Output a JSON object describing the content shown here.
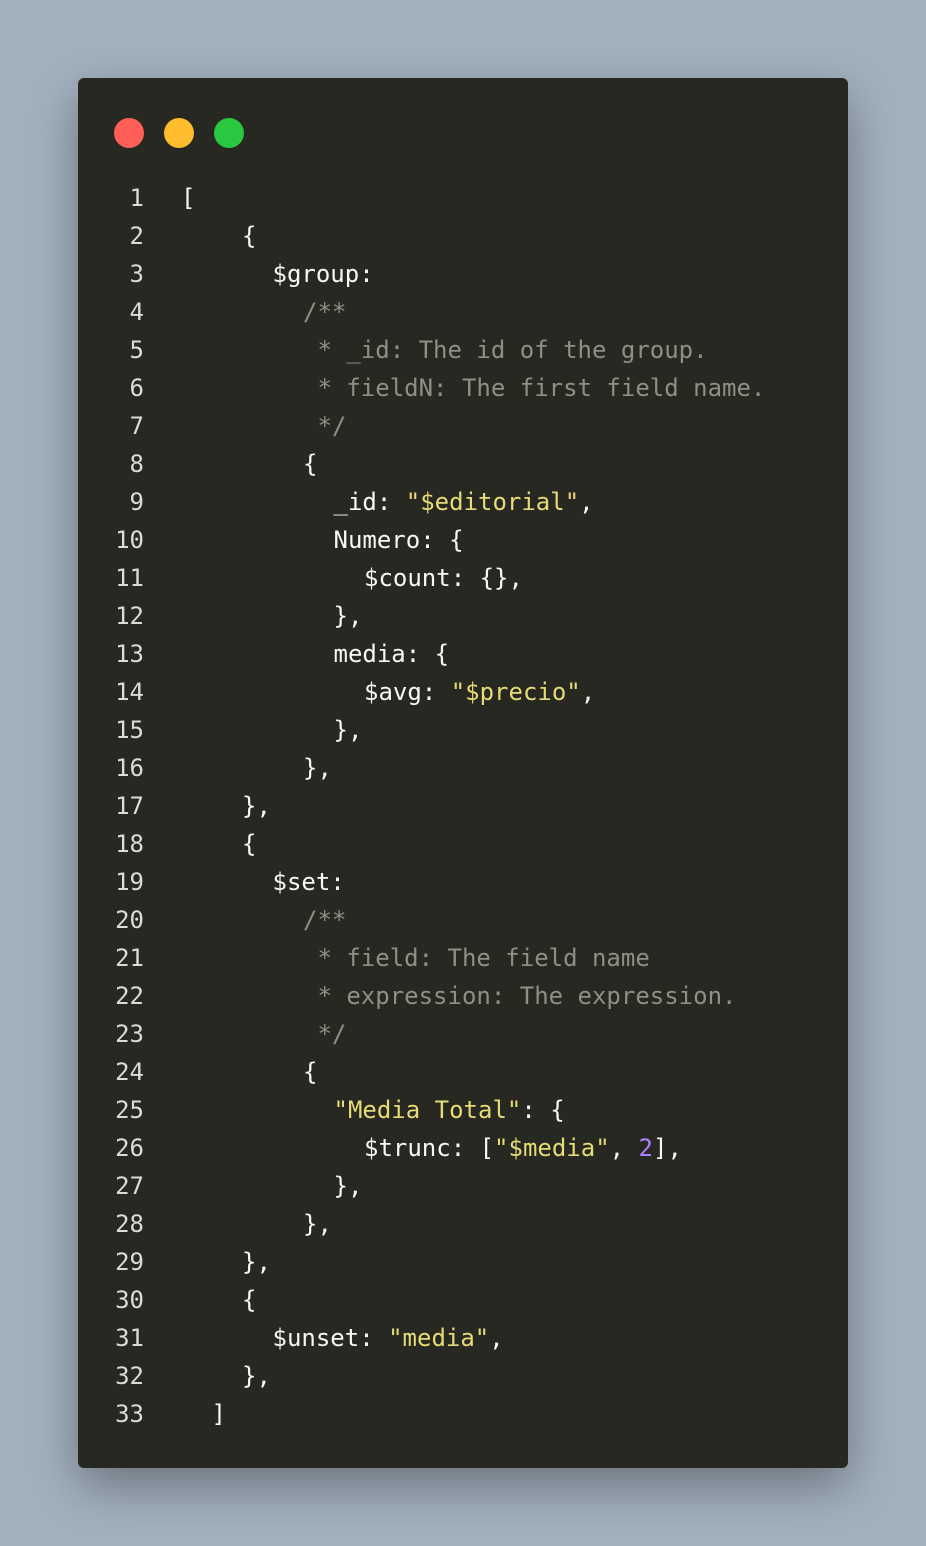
{
  "window": {
    "traffic_lights": [
      {
        "name": "close",
        "color": "#ff5f57"
      },
      {
        "name": "minimize",
        "color": "#febc2e"
      },
      {
        "name": "maximize",
        "color": "#28c840"
      }
    ]
  },
  "colors": {
    "background": "#a3b1bf",
    "editor": "#272822",
    "text": "#f8f8f2",
    "string": "#e6db74",
    "number": "#ae81ff",
    "comment": "#8f8f84"
  },
  "code": [
    {
      "n": "1",
      "indent": 0,
      "tokens": [
        {
          "t": "[",
          "k": "punct"
        }
      ]
    },
    {
      "n": "2",
      "indent": 2,
      "tokens": [
        {
          "t": "{",
          "k": "punct"
        }
      ]
    },
    {
      "n": "3",
      "indent": 3,
      "tokens": [
        {
          "t": "$group:",
          "k": "key"
        }
      ]
    },
    {
      "n": "4",
      "indent": 4,
      "tokens": [
        {
          "t": "/**",
          "k": "comment"
        }
      ]
    },
    {
      "n": "5",
      "indent": 4,
      "tokens": [
        {
          "t": " * _id: The id of the group.",
          "k": "comment"
        }
      ]
    },
    {
      "n": "6",
      "indent": 4,
      "tokens": [
        {
          "t": " * fieldN: The first field name.",
          "k": "comment"
        }
      ]
    },
    {
      "n": "7",
      "indent": 4,
      "tokens": [
        {
          "t": " */",
          "k": "comment"
        }
      ]
    },
    {
      "n": "8",
      "indent": 4,
      "tokens": [
        {
          "t": "{",
          "k": "punct"
        }
      ]
    },
    {
      "n": "9",
      "indent": 5,
      "tokens": [
        {
          "t": "_id: ",
          "k": "key"
        },
        {
          "t": "\"$editorial\"",
          "k": "str"
        },
        {
          "t": ",",
          "k": "punct"
        }
      ]
    },
    {
      "n": "10",
      "indent": 5,
      "tokens": [
        {
          "t": "Numero: {",
          "k": "key"
        }
      ]
    },
    {
      "n": "11",
      "indent": 6,
      "tokens": [
        {
          "t": "$count: {},",
          "k": "key"
        }
      ]
    },
    {
      "n": "12",
      "indent": 5,
      "tokens": [
        {
          "t": "},",
          "k": "punct"
        }
      ]
    },
    {
      "n": "13",
      "indent": 5,
      "tokens": [
        {
          "t": "media: {",
          "k": "key"
        }
      ]
    },
    {
      "n": "14",
      "indent": 6,
      "tokens": [
        {
          "t": "$avg: ",
          "k": "key"
        },
        {
          "t": "\"$precio\"",
          "k": "str"
        },
        {
          "t": ",",
          "k": "punct"
        }
      ]
    },
    {
      "n": "15",
      "indent": 5,
      "tokens": [
        {
          "t": "},",
          "k": "punct"
        }
      ]
    },
    {
      "n": "16",
      "indent": 4,
      "tokens": [
        {
          "t": "},",
          "k": "punct"
        }
      ]
    },
    {
      "n": "17",
      "indent": 2,
      "tokens": [
        {
          "t": "},",
          "k": "punct"
        }
      ]
    },
    {
      "n": "18",
      "indent": 2,
      "tokens": [
        {
          "t": "{",
          "k": "punct"
        }
      ]
    },
    {
      "n": "19",
      "indent": 3,
      "tokens": [
        {
          "t": "$set:",
          "k": "key"
        }
      ]
    },
    {
      "n": "20",
      "indent": 4,
      "tokens": [
        {
          "t": "/**",
          "k": "comment"
        }
      ]
    },
    {
      "n": "21",
      "indent": 4,
      "tokens": [
        {
          "t": " * field: The field name",
          "k": "comment"
        }
      ]
    },
    {
      "n": "22",
      "indent": 4,
      "tokens": [
        {
          "t": " * expression: The expression.",
          "k": "comment"
        }
      ]
    },
    {
      "n": "23",
      "indent": 4,
      "tokens": [
        {
          "t": " */",
          "k": "comment"
        }
      ]
    },
    {
      "n": "24",
      "indent": 4,
      "tokens": [
        {
          "t": "{",
          "k": "punct"
        }
      ]
    },
    {
      "n": "25",
      "indent": 5,
      "tokens": [
        {
          "t": "\"Media Total\"",
          "k": "str"
        },
        {
          "t": ": {",
          "k": "punct"
        }
      ]
    },
    {
      "n": "26",
      "indent": 6,
      "tokens": [
        {
          "t": "$trunc: [",
          "k": "key"
        },
        {
          "t": "\"$media\"",
          "k": "str"
        },
        {
          "t": ", ",
          "k": "punct"
        },
        {
          "t": "2",
          "k": "num"
        },
        {
          "t": "],",
          "k": "punct"
        }
      ]
    },
    {
      "n": "27",
      "indent": 5,
      "tokens": [
        {
          "t": "},",
          "k": "punct"
        }
      ]
    },
    {
      "n": "28",
      "indent": 4,
      "tokens": [
        {
          "t": "},",
          "k": "punct"
        }
      ]
    },
    {
      "n": "29",
      "indent": 2,
      "tokens": [
        {
          "t": "},",
          "k": "punct"
        }
      ]
    },
    {
      "n": "30",
      "indent": 2,
      "tokens": [
        {
          "t": "{",
          "k": "punct"
        }
      ]
    },
    {
      "n": "31",
      "indent": 3,
      "tokens": [
        {
          "t": "$unset: ",
          "k": "key"
        },
        {
          "t": "\"media\"",
          "k": "str"
        },
        {
          "t": ",",
          "k": "punct"
        }
      ]
    },
    {
      "n": "32",
      "indent": 2,
      "tokens": [
        {
          "t": "},",
          "k": "punct"
        }
      ]
    },
    {
      "n": "33",
      "indent": 1,
      "tokens": [
        {
          "t": "]",
          "k": "punct"
        }
      ]
    }
  ]
}
